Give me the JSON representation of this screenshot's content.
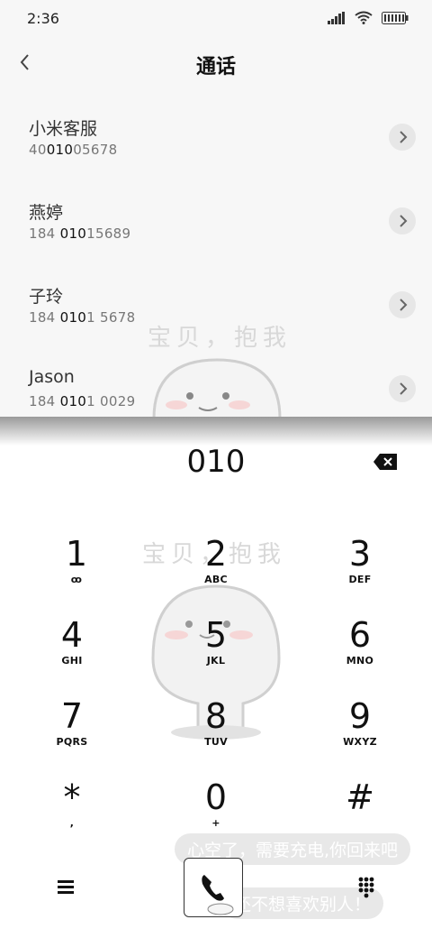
{
  "status_bar": {
    "time": "2:36"
  },
  "header": {
    "title": "通话"
  },
  "contacts": [
    {
      "name": "小米客服",
      "num_pre": "40",
      "num_match": "010",
      "num_post": "05678"
    },
    {
      "name": "燕婷",
      "num_pre": "184 ",
      "num_match": "010",
      "num_post": "15689"
    },
    {
      "name": "子玲",
      "num_pre": "184 ",
      "num_match": "010",
      "num_post": "1 5678"
    },
    {
      "name": "Jason",
      "num_pre": "184 ",
      "num_match": "010",
      "num_post": "1 0029"
    }
  ],
  "watermark": {
    "text": "宝贝，抱我"
  },
  "dialer": {
    "input_value": "010",
    "keys": [
      {
        "digit": "1",
        "letters": "ꝏ"
      },
      {
        "digit": "2",
        "letters": "ABC"
      },
      {
        "digit": "3",
        "letters": "DEF"
      },
      {
        "digit": "4",
        "letters": "GHI"
      },
      {
        "digit": "5",
        "letters": "JKL"
      },
      {
        "digit": "6",
        "letters": "MNO"
      },
      {
        "digit": "7",
        "letters": "PQRS"
      },
      {
        "digit": "8",
        "letters": "TUV"
      },
      {
        "digit": "9",
        "letters": "WXYZ"
      },
      {
        "digit": "*",
        "letters": ","
      },
      {
        "digit": "0",
        "letters": "+"
      },
      {
        "digit": "#",
        "letters": ""
      }
    ]
  },
  "bubbles": {
    "top": "心空了，需要充电,你回来吧",
    "bottom": "还不想喜欢别人！"
  },
  "icons": {
    "back": "chevron-left-icon",
    "delete": "backspace-icon",
    "menu": "menu-icon",
    "call": "phone-icon",
    "dialpad": "dialpad-grid-icon"
  }
}
